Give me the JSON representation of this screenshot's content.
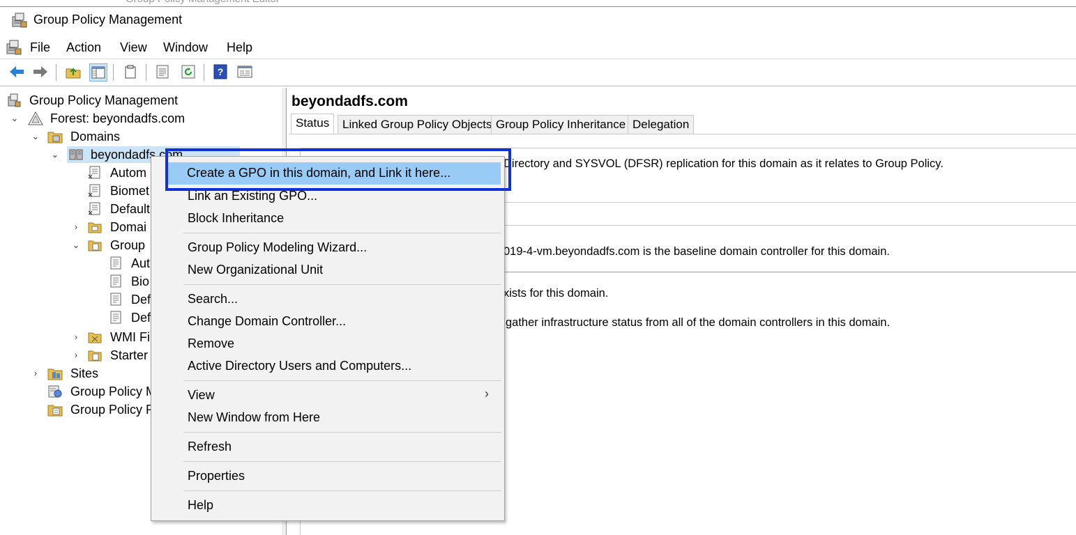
{
  "background_window_title": "Group Policy Management Editor",
  "window": {
    "title": "Group Policy Management"
  },
  "menu": [
    "File",
    "Action",
    "View",
    "Window",
    "Help"
  ],
  "toolbar": [
    "back-icon",
    "forward-icon",
    "up-folder-icon",
    "show-hide-tree-icon",
    "clipboard-icon",
    "properties-icon",
    "refresh-icon",
    "help-icon",
    "console-view-icon"
  ],
  "tree": {
    "root": "Group Policy Management",
    "forest": "Forest: beyondadfs.com",
    "domains": "Domains",
    "domain": "beyondadfs.com",
    "children": [
      "Autom",
      "Biomet",
      "Default",
      "Domai",
      "Group"
    ],
    "gpo_children": [
      "Aut",
      "Bio",
      "Def",
      "Def"
    ],
    "wmi": "WMI Fi",
    "starter": "Starter",
    "sites": "Sites",
    "modeling": "Group Policy M",
    "results": "Group Policy R"
  },
  "detail": {
    "title": "beyondadfs.com",
    "tabs": [
      "Status",
      "Linked Group Policy Objects",
      "Group Policy Inheritance",
      "Delegation"
    ],
    "status_lines": [
      "Directory and SYSVOL (DFSR) replication for this domain as it relates to Group Policy.",
      "019-4-vm.beyondadfs.com is the baseline domain controller for this domain.",
      "xists for this domain.",
      "gather infrastructure status from all of the domain controllers in this domain."
    ]
  },
  "context_menu": {
    "items": [
      "Create a GPO in this domain, and Link it here...",
      "Link an Existing GPO...",
      "Block Inheritance",
      "Group Policy Modeling Wizard...",
      "New Organizational Unit",
      "Search...",
      "Change Domain Controller...",
      "Remove",
      "Active Directory Users and Computers...",
      "View",
      "New Window from Here",
      "Refresh",
      "Properties",
      "Help"
    ]
  },
  "colors": {
    "highlight": "#99cbf7",
    "focus_box": "#1030d8"
  }
}
